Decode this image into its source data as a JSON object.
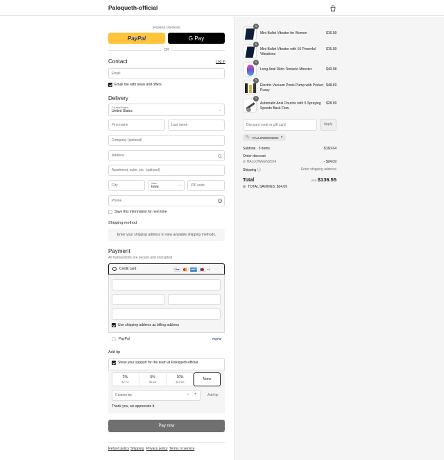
{
  "header": {
    "brand": "Paloqueth-official"
  },
  "express": {
    "label": "Express checkout",
    "paypal": "PayPal",
    "gpay": "G Pay",
    "or": "OR"
  },
  "contact": {
    "title": "Contact",
    "login": "Log in",
    "email_placeholder": "Email",
    "news_label": "Email me with news and offers"
  },
  "delivery": {
    "title": "Delivery",
    "country_label": "Country/Region",
    "country_value": "United States",
    "first_name": "First name",
    "last_name": "Last name",
    "company": "Company (optional)",
    "address": "Address",
    "apartment": "Apartment, suite, etc. (optional)",
    "city": "City",
    "state_label": "State",
    "state_value": "Iowa",
    "zip": "ZIP code",
    "phone": "Phone",
    "save_info": "Save this information for next time"
  },
  "shipping": {
    "title": "Shipping method",
    "message": "Enter your shipping address to view available shipping methods."
  },
  "payment": {
    "title": "Payment",
    "subtitle": "All transactions are secure and encrypted.",
    "credit_card": "Credit card",
    "cards": [
      "Visa",
      "MC",
      "AMEX",
      "Maestro"
    ],
    "more": "+4",
    "billing": "Use shipping address as billing address",
    "paypal": "PayPal",
    "paypal_logo": "PayPal"
  },
  "tip": {
    "title": "Add tip",
    "support": "Show your support for the team at Paloqueth-official",
    "options": [
      {
        "pct": "2%",
        "amt": "$2.73"
      },
      {
        "pct": "5%",
        "amt": "$6.83"
      },
      {
        "pct": "10%",
        "amt": "$13.66"
      },
      {
        "pct": "None",
        "amt": ""
      }
    ],
    "custom": "Custom tip",
    "add": "Add tip",
    "thanks": "Thank you, we appreciate it."
  },
  "pay_now": "Pay now",
  "footer": [
    "Refund policy",
    "Shipping",
    "Privacy policy",
    "Terms of service"
  ],
  "cart": {
    "items": [
      {
        "qty": "1",
        "name": "Mini Bullet Vibrator for Women",
        "price": "$16.99"
      },
      {
        "qty": "1",
        "name": "Mini Bullet Vibrator with 10 Powerful Vibrations",
        "price": "$15.99"
      },
      {
        "qty": "1",
        "name": "Long Anal Dildo Tentacle Monster",
        "price": "$49.98"
      },
      {
        "qty": "1",
        "name": "Electric Vacuum Penis Pump with Pocket Pussy",
        "price": "$48.69"
      },
      {
        "qty": "1",
        "name": "Automatic Anal Douche with 5 Spraying Speeds Back Flow",
        "price": "$28.99"
      }
    ],
    "discount_placeholder": "Discount code or gift card",
    "apply": "Apply",
    "code_tag": "HALLOWEEN2024",
    "subtotal_label": "Subtotal · 5 items",
    "subtotal": "$160.64",
    "order_discount": "Order discount",
    "discount_code": "HALLOWEEN2024",
    "discount_amt": "- $24.09",
    "shipping_label": "Shipping",
    "shipping_value": "Enter shipping address",
    "total_label": "Total",
    "currency": "USD",
    "total": "$136.55",
    "savings": "TOTAL SAVINGS: $24.09"
  },
  "colors": {
    "paypal": "#ffc439",
    "accent": "#1a1a1a",
    "pay_button": "#707070"
  }
}
